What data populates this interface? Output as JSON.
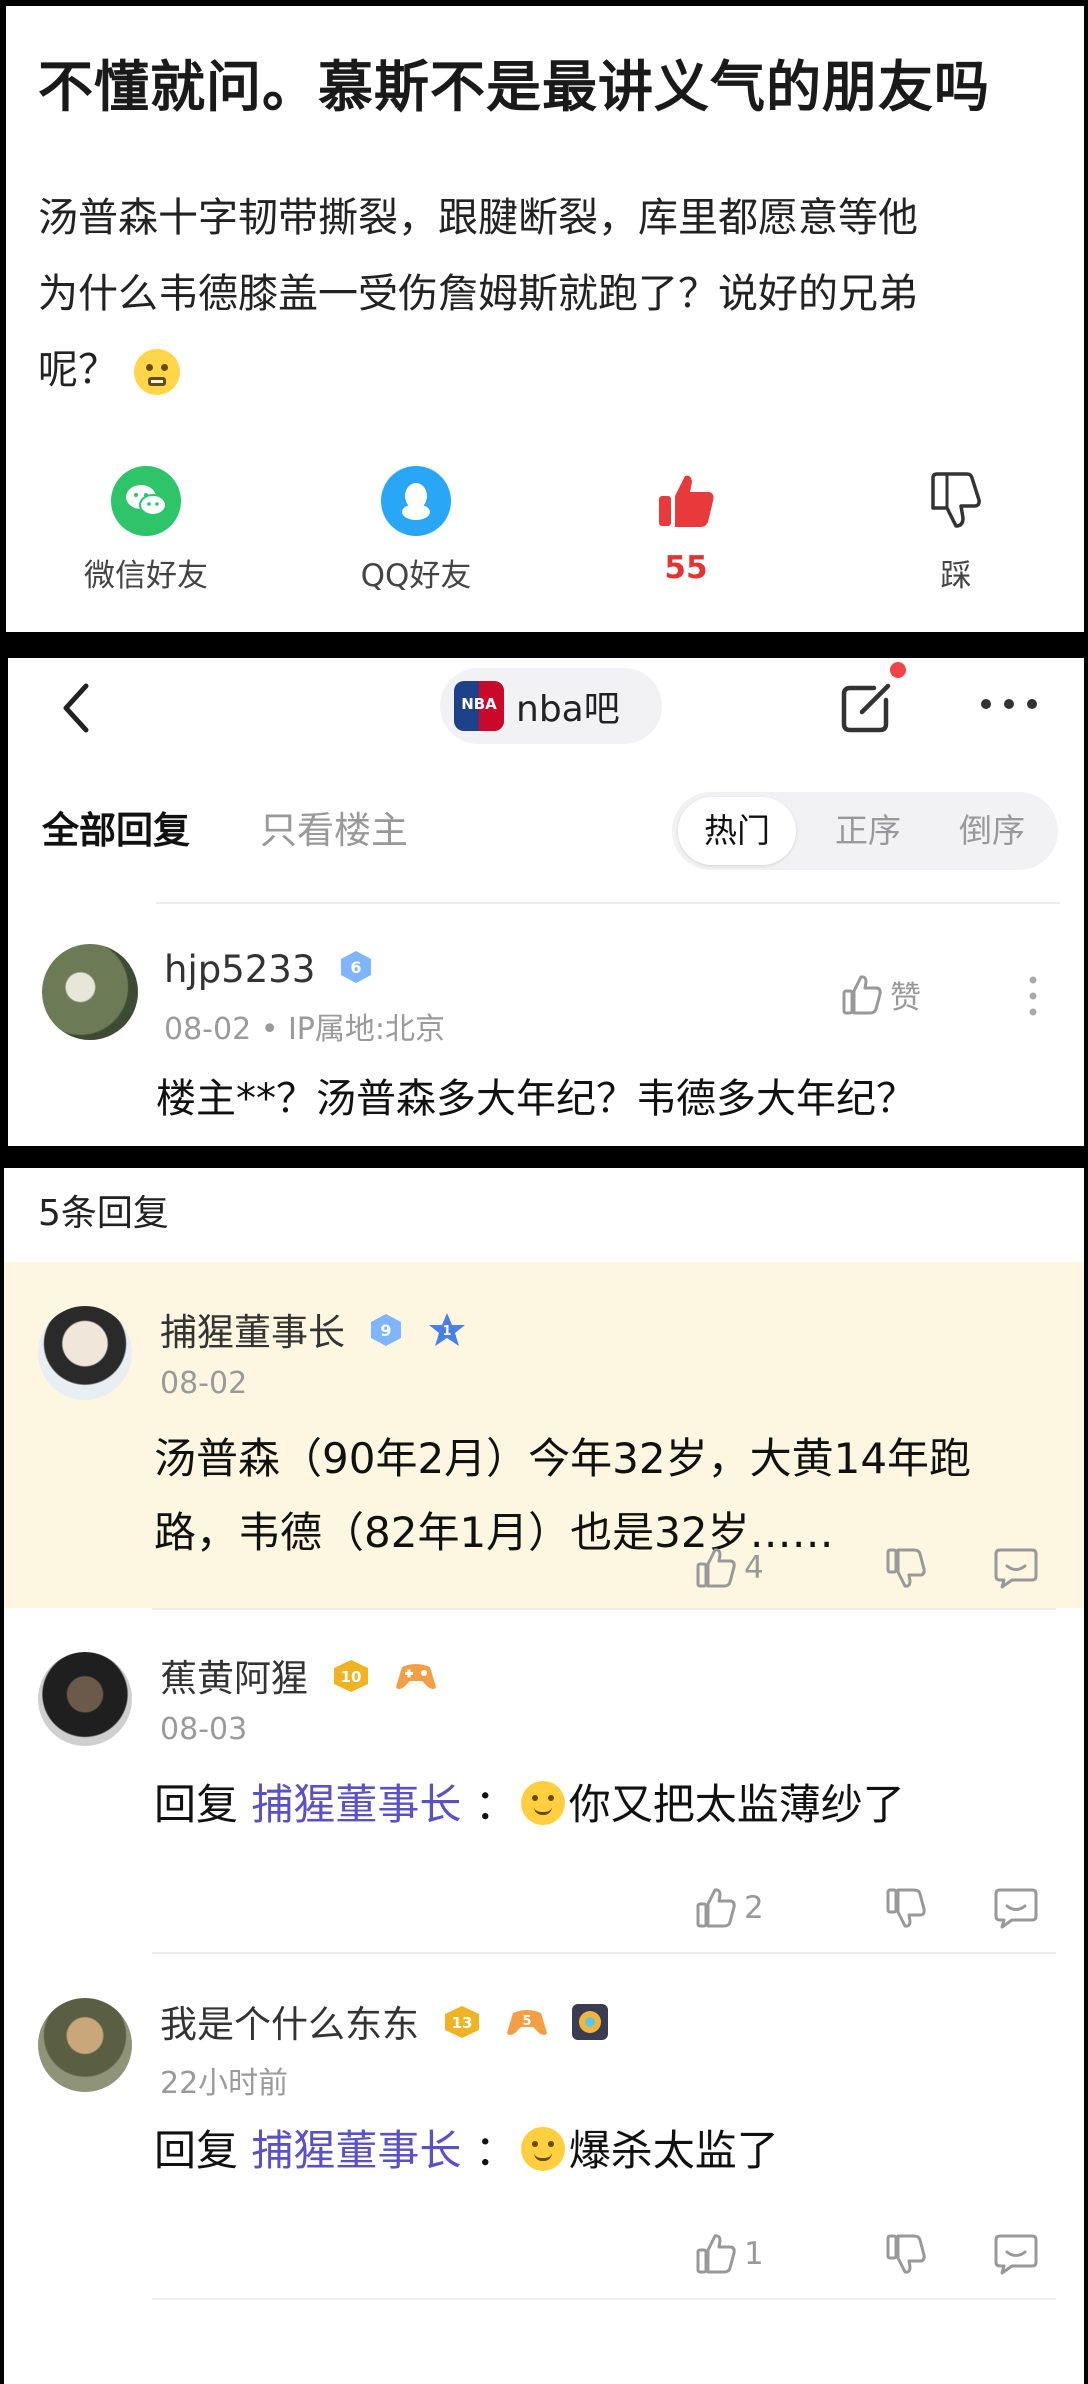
{
  "post": {
    "title": "不懂就问。慕斯不是最讲义气的朋友吗",
    "body_line1": "汤普森十字韧带撕裂，跟腱断裂，库里都愿意等他",
    "body_line2": "为什么韦德膝盖一受伤詹姆斯就跑了？说好的兄弟",
    "body_line3": "呢？",
    "share": {
      "wechat_label": "微信好友",
      "qq_label": "QQ好友",
      "like_count": "55",
      "dislike_label": "踩"
    }
  },
  "thread": {
    "forum_logo_text": "NBA",
    "forum_name": "nba吧",
    "tab_all": "全部回复",
    "tab_op_only": "只看楼主",
    "sort": {
      "hot": "热门",
      "asc": "正序",
      "desc": "倒序"
    }
  },
  "comment": {
    "username": "hjp5233",
    "level": "6",
    "meta": "08-02  •  IP属地:北京",
    "like_label": "赞",
    "text": "楼主**？汤普森多大年纪？韦德多大年纪？"
  },
  "replies_header": "5条回复",
  "replies": [
    {
      "username": "捕猩董事长",
      "level": "9",
      "badge2": "1",
      "time": "08-02",
      "line1": "汤普森（90年2月）今年32岁，大黄14年跑",
      "line2": "路，韦德（82年1月）也是32岁……",
      "likes": "4"
    },
    {
      "username": "蕉黄阿猩",
      "level": "10",
      "time": "08-03",
      "reply_prefix": "回复",
      "mention": "捕猩董事长",
      "colon": "：",
      "text": "你又把太监薄纱了",
      "likes": "2"
    },
    {
      "username": "我是个什么东东",
      "level": "13",
      "badge2": "5",
      "time": "22小时前",
      "reply_prefix": "回复",
      "mention": "捕猩董事长",
      "colon": "：",
      "text": "爆杀太监了",
      "likes": "1"
    }
  ]
}
